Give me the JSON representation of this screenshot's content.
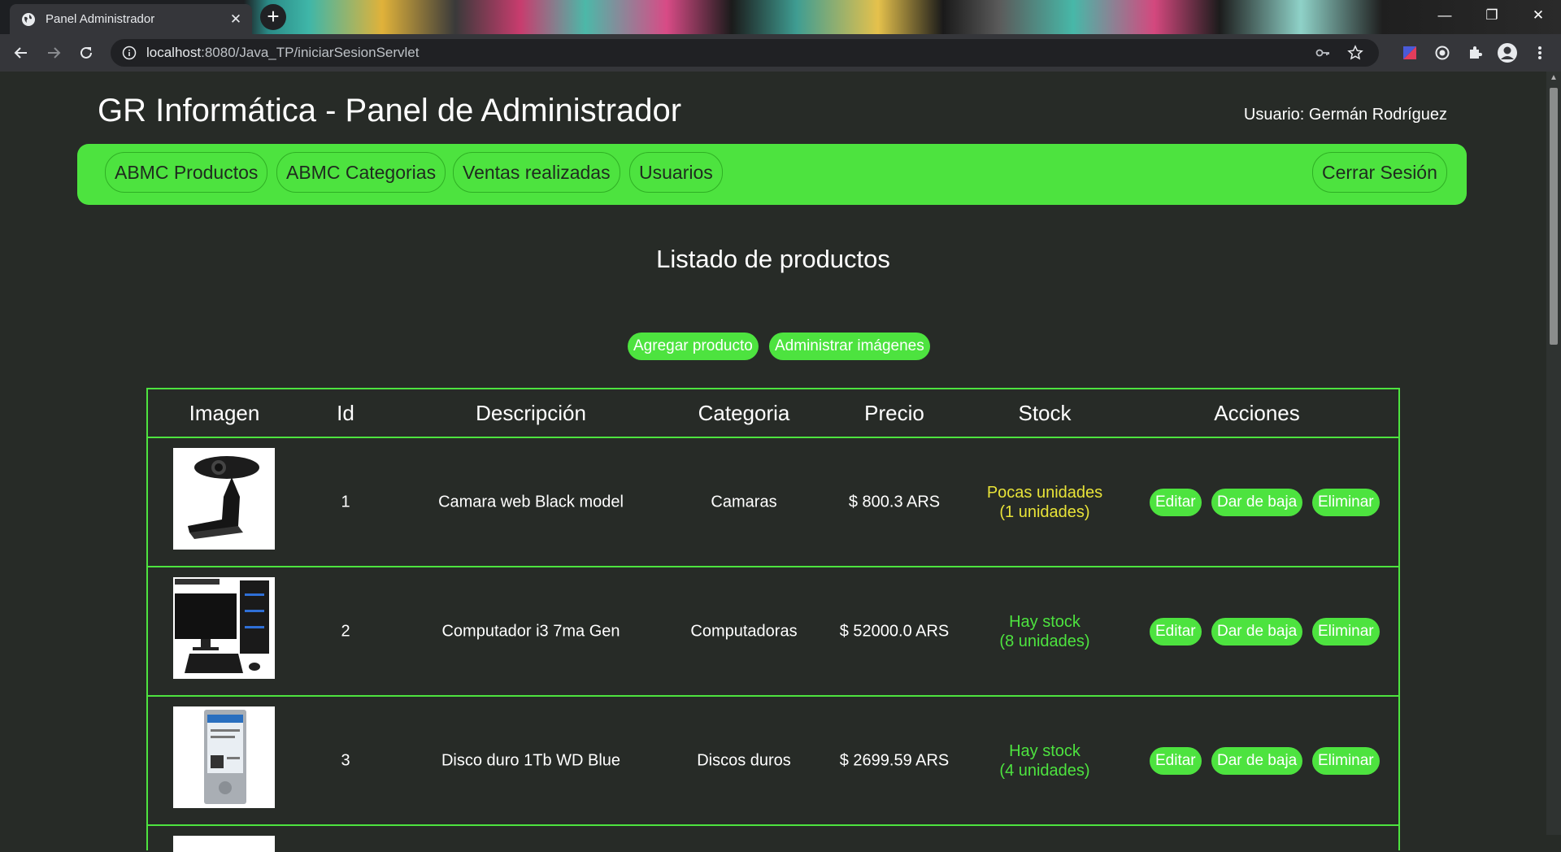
{
  "browser": {
    "tab_title": "Panel Administrador",
    "tab_close": "✕",
    "new_tab": "+",
    "url_host": "localhost",
    "url_path": ":8080/Java_TP/iniciarSesionServlet",
    "window_controls": {
      "minimize": "—",
      "restore": "❐",
      "close": "✕"
    }
  },
  "header": {
    "title": "GR Informática - Panel de Administrador",
    "user": "Usuario: Germán Rodríguez"
  },
  "nav": {
    "items": [
      "ABMC Productos",
      "ABMC Categorias",
      "Ventas realizadas",
      "Usuarios"
    ],
    "logout": "Cerrar Sesión"
  },
  "main": {
    "title": "Listado de productos",
    "add_product": "Agregar producto",
    "manage_images": "Administrar imágenes"
  },
  "table": {
    "headers": [
      "Imagen",
      "Id",
      "Descripción",
      "Categoria",
      "Precio",
      "Stock",
      "Acciones"
    ],
    "rows": [
      {
        "id": "1",
        "description": "Camara web Black model",
        "category": "Camaras",
        "price": "$ 800.3 ARS",
        "stock_status": "Pocas unidades",
        "stock_units": "(1 unidades)",
        "image": "webcam-image"
      },
      {
        "id": "2",
        "description": "Computador i3 7ma Gen",
        "category": "Computadoras",
        "price": "$ 52000.0 ARS",
        "stock_status": "Hay stock",
        "stock_units": "(8 unidades)",
        "image": "computer-image"
      },
      {
        "id": "3",
        "description": "Disco duro 1Tb WD Blue",
        "category": "Discos duros",
        "price": "$ 2699.59 ARS",
        "stock_status": "Hay stock",
        "stock_units": "(4 unidades)",
        "image": "hard-drive-image"
      }
    ],
    "actions": {
      "edit": "Editar",
      "deactivate": "Dar de baja",
      "delete": "Eliminar"
    }
  },
  "colors": {
    "accent": "#4de33f",
    "background": "#272b27",
    "low_stock": "#e8e338"
  }
}
